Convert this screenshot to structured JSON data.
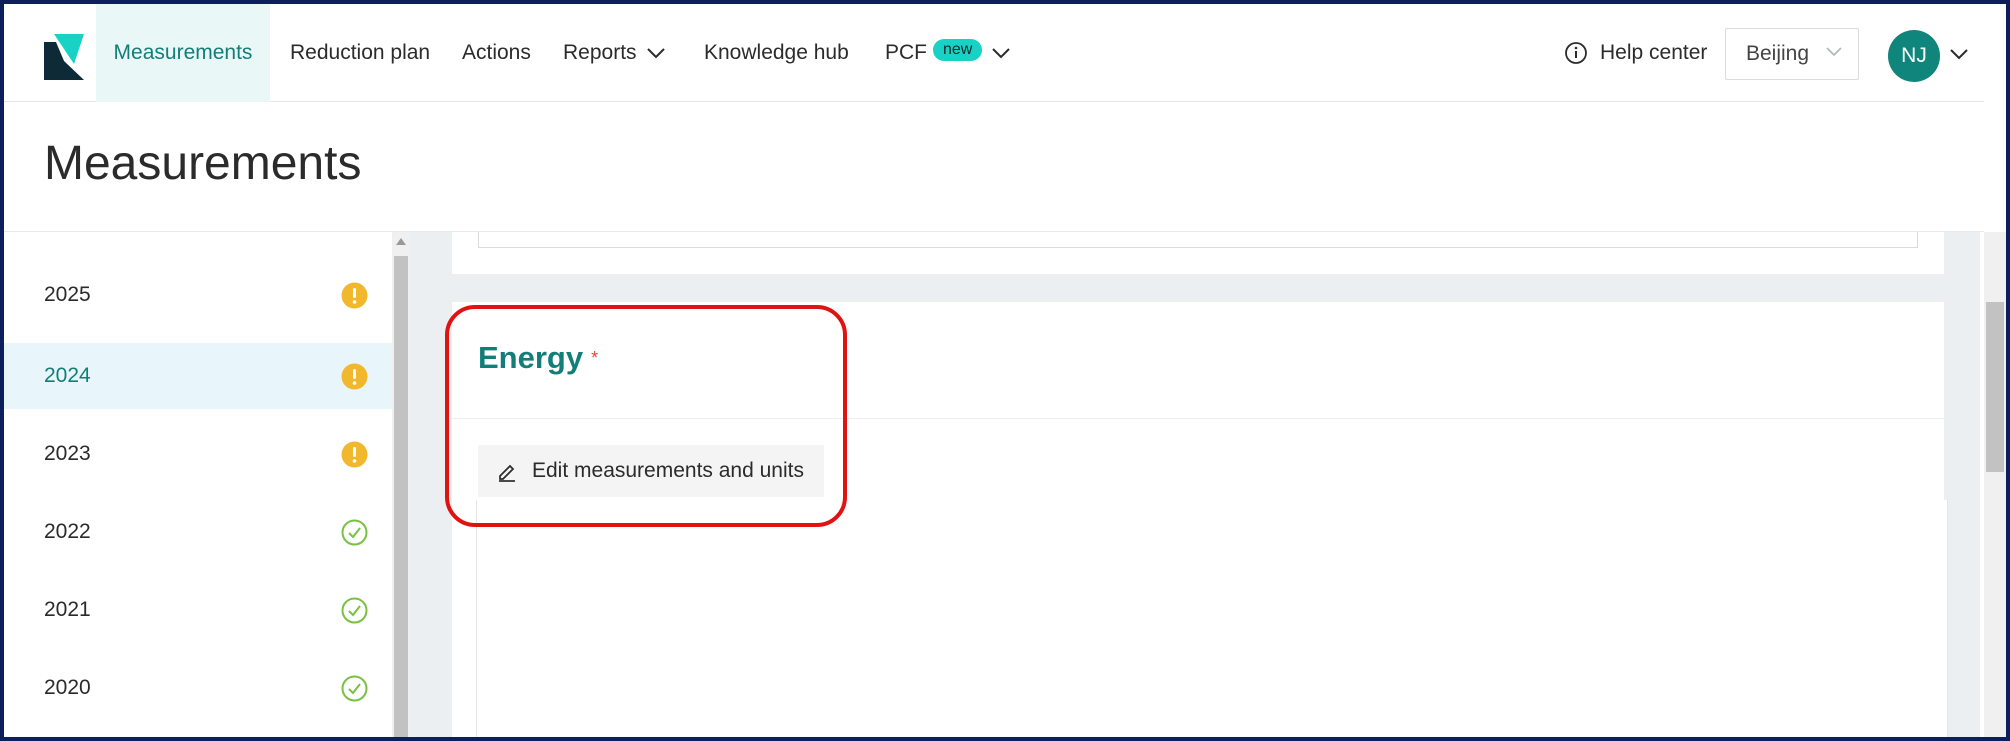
{
  "nav": {
    "items": [
      {
        "label": "Measurements",
        "active": true
      },
      {
        "label": "Reduction plan"
      },
      {
        "label": "Actions"
      },
      {
        "label": "Reports"
      },
      {
        "label": "Knowledge hub"
      },
      {
        "label": "PCF",
        "badge": "new"
      }
    ],
    "help_label": "Help center",
    "location": "Beijing",
    "user_initials": "NJ"
  },
  "page_title": "Measurements",
  "sidebar": {
    "years": [
      {
        "year": "2025",
        "status": "warning-icon"
      },
      {
        "year": "2024",
        "status": "warning-icon",
        "active": true
      },
      {
        "year": "2023",
        "status": "warning-icon"
      },
      {
        "year": "2022",
        "status": "check-icon"
      },
      {
        "year": "2021",
        "status": "check-icon"
      },
      {
        "year": "2020",
        "status": "check-icon"
      }
    ]
  },
  "section": {
    "title": "Energy",
    "required_mark": "*",
    "edit_label": "Edit measurements and units"
  },
  "colors": {
    "accent": "#117f78",
    "warning": "#f1b82d",
    "success": "#79c143",
    "highlight": "#e01212"
  }
}
